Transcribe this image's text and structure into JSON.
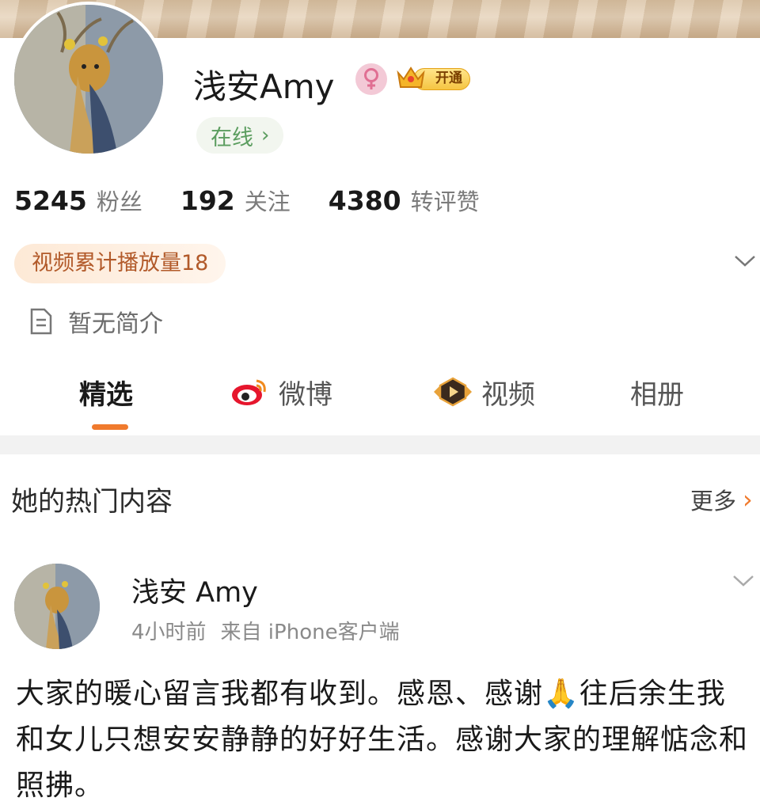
{
  "profile": {
    "name": "浅安Amy",
    "vip_label": "开通",
    "status": "在线",
    "stats": [
      {
        "value": "5245",
        "label": "粉丝"
      },
      {
        "value": "192",
        "label": "关注"
      },
      {
        "value": "4380",
        "label": "转评赞"
      }
    ],
    "video_plays": "视频累计播放量18",
    "bio": "暂无简介"
  },
  "tabs": [
    {
      "label": "精选",
      "active": true
    },
    {
      "label": "微博"
    },
    {
      "label": "视频"
    },
    {
      "label": "相册"
    }
  ],
  "section": {
    "title": "她的热门内容",
    "more": "更多"
  },
  "post": {
    "author": "浅安 Amy",
    "time": "4小时前",
    "source": "来自 iPhone客户端",
    "body": "大家的暖心留言我都有收到。感恩、感谢🙏往后余生我和女儿只想安安静静的好好生活。感谢大家的理解惦念和照拂。"
  },
  "colors": {
    "accent": "#f07a2d",
    "online_green": "#5b9d5f",
    "gender_pink": "#e06f93",
    "plays_text": "#b25a2a"
  }
}
